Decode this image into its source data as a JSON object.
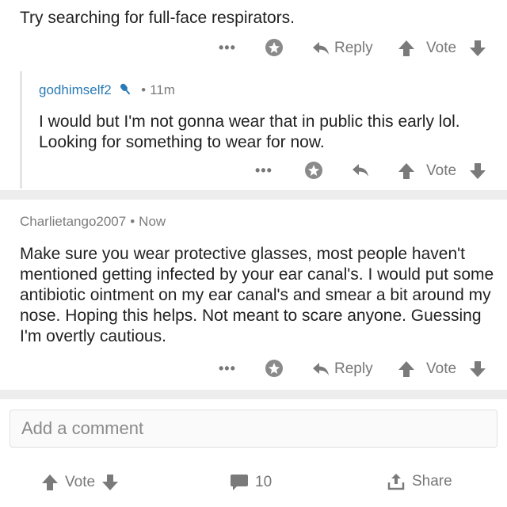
{
  "comments": [
    {
      "text": "Try searching for full-face respirators.",
      "actions": {
        "more": "•••",
        "reply": "Reply",
        "vote": "Vote"
      }
    },
    {
      "author": "godhimself2",
      "time": "11m",
      "text": "I would but I'm not gonna wear that in public this early lol. Looking for something to wear for now.",
      "actions": {
        "more": "•••",
        "vote": "Vote"
      }
    },
    {
      "author": "Charlietango2007",
      "time": "Now",
      "text": "Make sure you wear protective glasses, most people haven't mentioned getting infected by your ear canal's. I would put some antibiotic ointment on my ear canal's and smear a bit around my nose. Hoping this helps. Not meant to scare anyone. Guessing I'm overtly cautious.",
      "actions": {
        "more": "•••",
        "reply": "Reply",
        "vote": "Vote"
      }
    }
  ],
  "separator": "•",
  "add_comment": {
    "placeholder": "Add a comment"
  },
  "footer": {
    "vote": "Vote",
    "comment_count": "10",
    "share": "Share"
  },
  "colors": {
    "op_blue": "#2a7ab4",
    "grey": "#777777",
    "band": "#ededed"
  },
  "icons": [
    "more-icon",
    "gild-icon",
    "reply-arrow-icon",
    "upvote-icon",
    "downvote-icon",
    "microphone-icon",
    "comment-bubble-icon",
    "share-icon"
  ]
}
